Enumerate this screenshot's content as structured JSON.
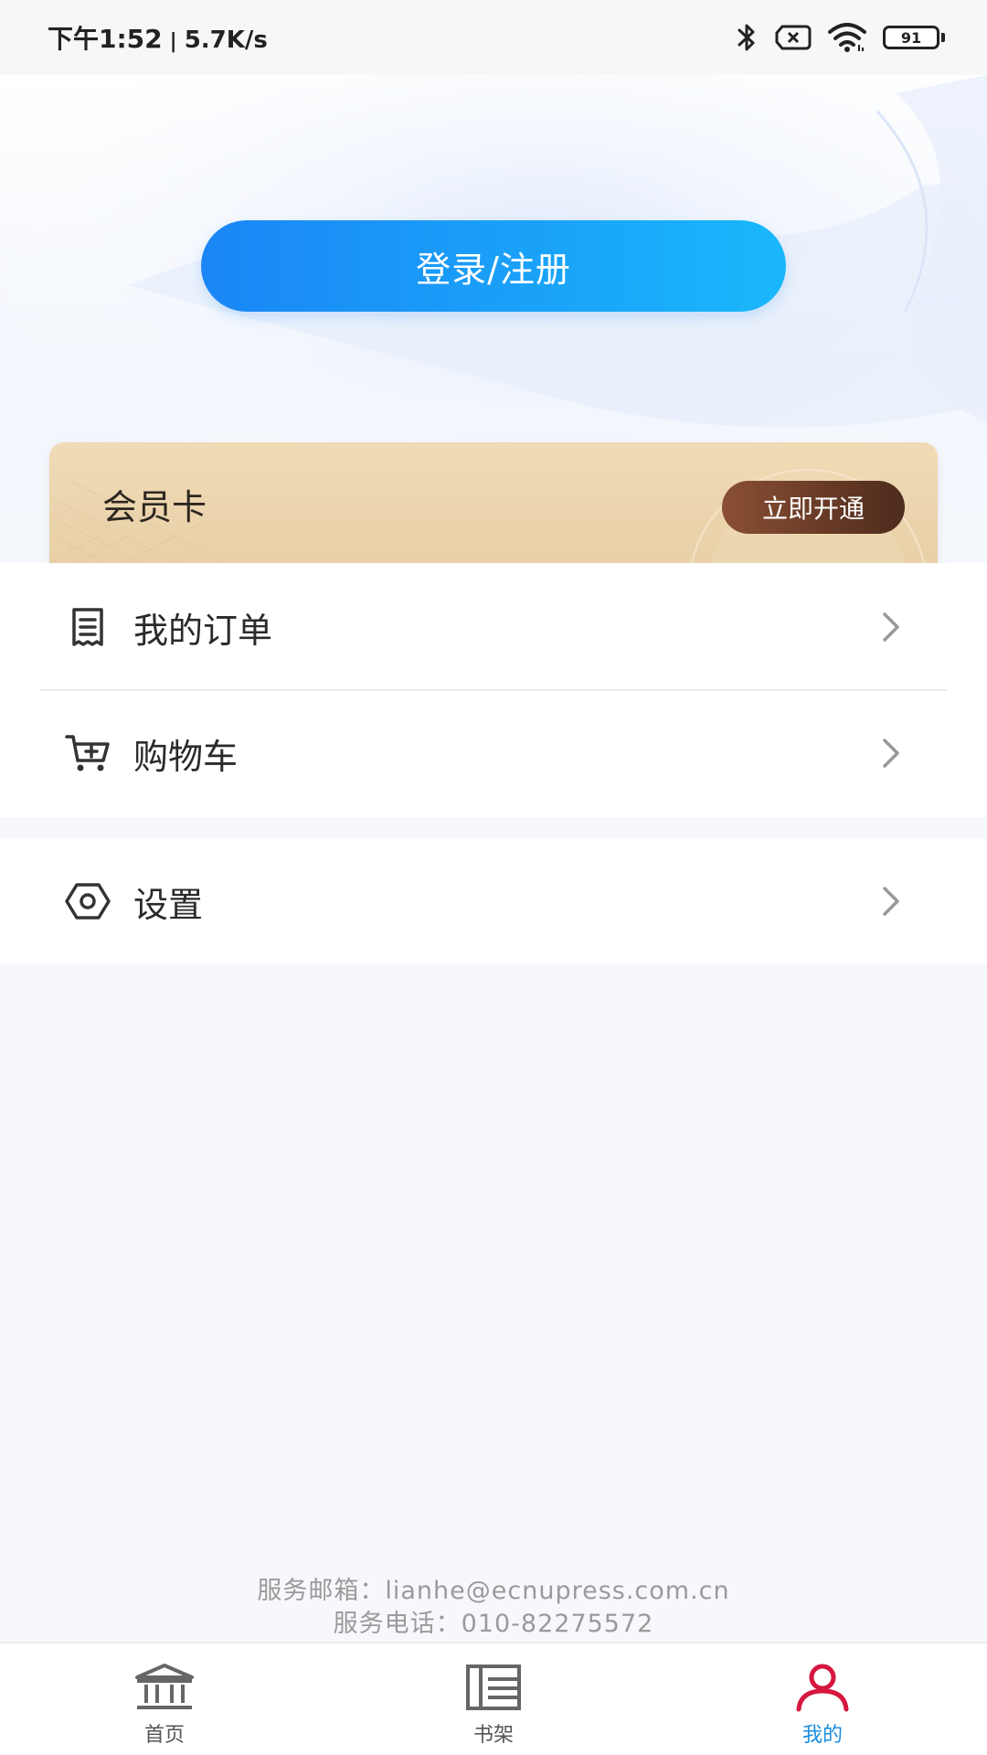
{
  "status_bar": {
    "time": "下午1:52",
    "separator": "|",
    "speed": "5.7K/s",
    "battery": "91",
    "icons": [
      "bluetooth-icon",
      "no-sim-icon",
      "wifi-icon",
      "battery-icon"
    ]
  },
  "header": {
    "login_label": "登录/注册"
  },
  "member_card": {
    "title": "会员卡",
    "open_label": "立即开通"
  },
  "menu": {
    "items": [
      {
        "label": "我的订单",
        "icon": "receipt-icon"
      },
      {
        "label": "购物车",
        "icon": "cart-icon"
      },
      {
        "label": "设置",
        "icon": "settings-icon"
      }
    ]
  },
  "footer": {
    "email": "服务邮箱：lianhe@ecnupress.com.cn",
    "phone": "服务电话：010-82275572"
  },
  "bottom_nav": {
    "items": [
      {
        "label": "首页",
        "icon": "home-icon"
      },
      {
        "label": "书架",
        "icon": "bookshelf-icon"
      },
      {
        "label": "我的",
        "icon": "profile-icon"
      }
    ],
    "active_index": 2
  },
  "colors": {
    "accent": "#1a8ce0",
    "login_start": "#1a86f5",
    "login_end": "#1ab7fb",
    "profile_icon": "#d6173f",
    "member_bg": "#ecd5ae",
    "member_button": "#6b3b27"
  }
}
